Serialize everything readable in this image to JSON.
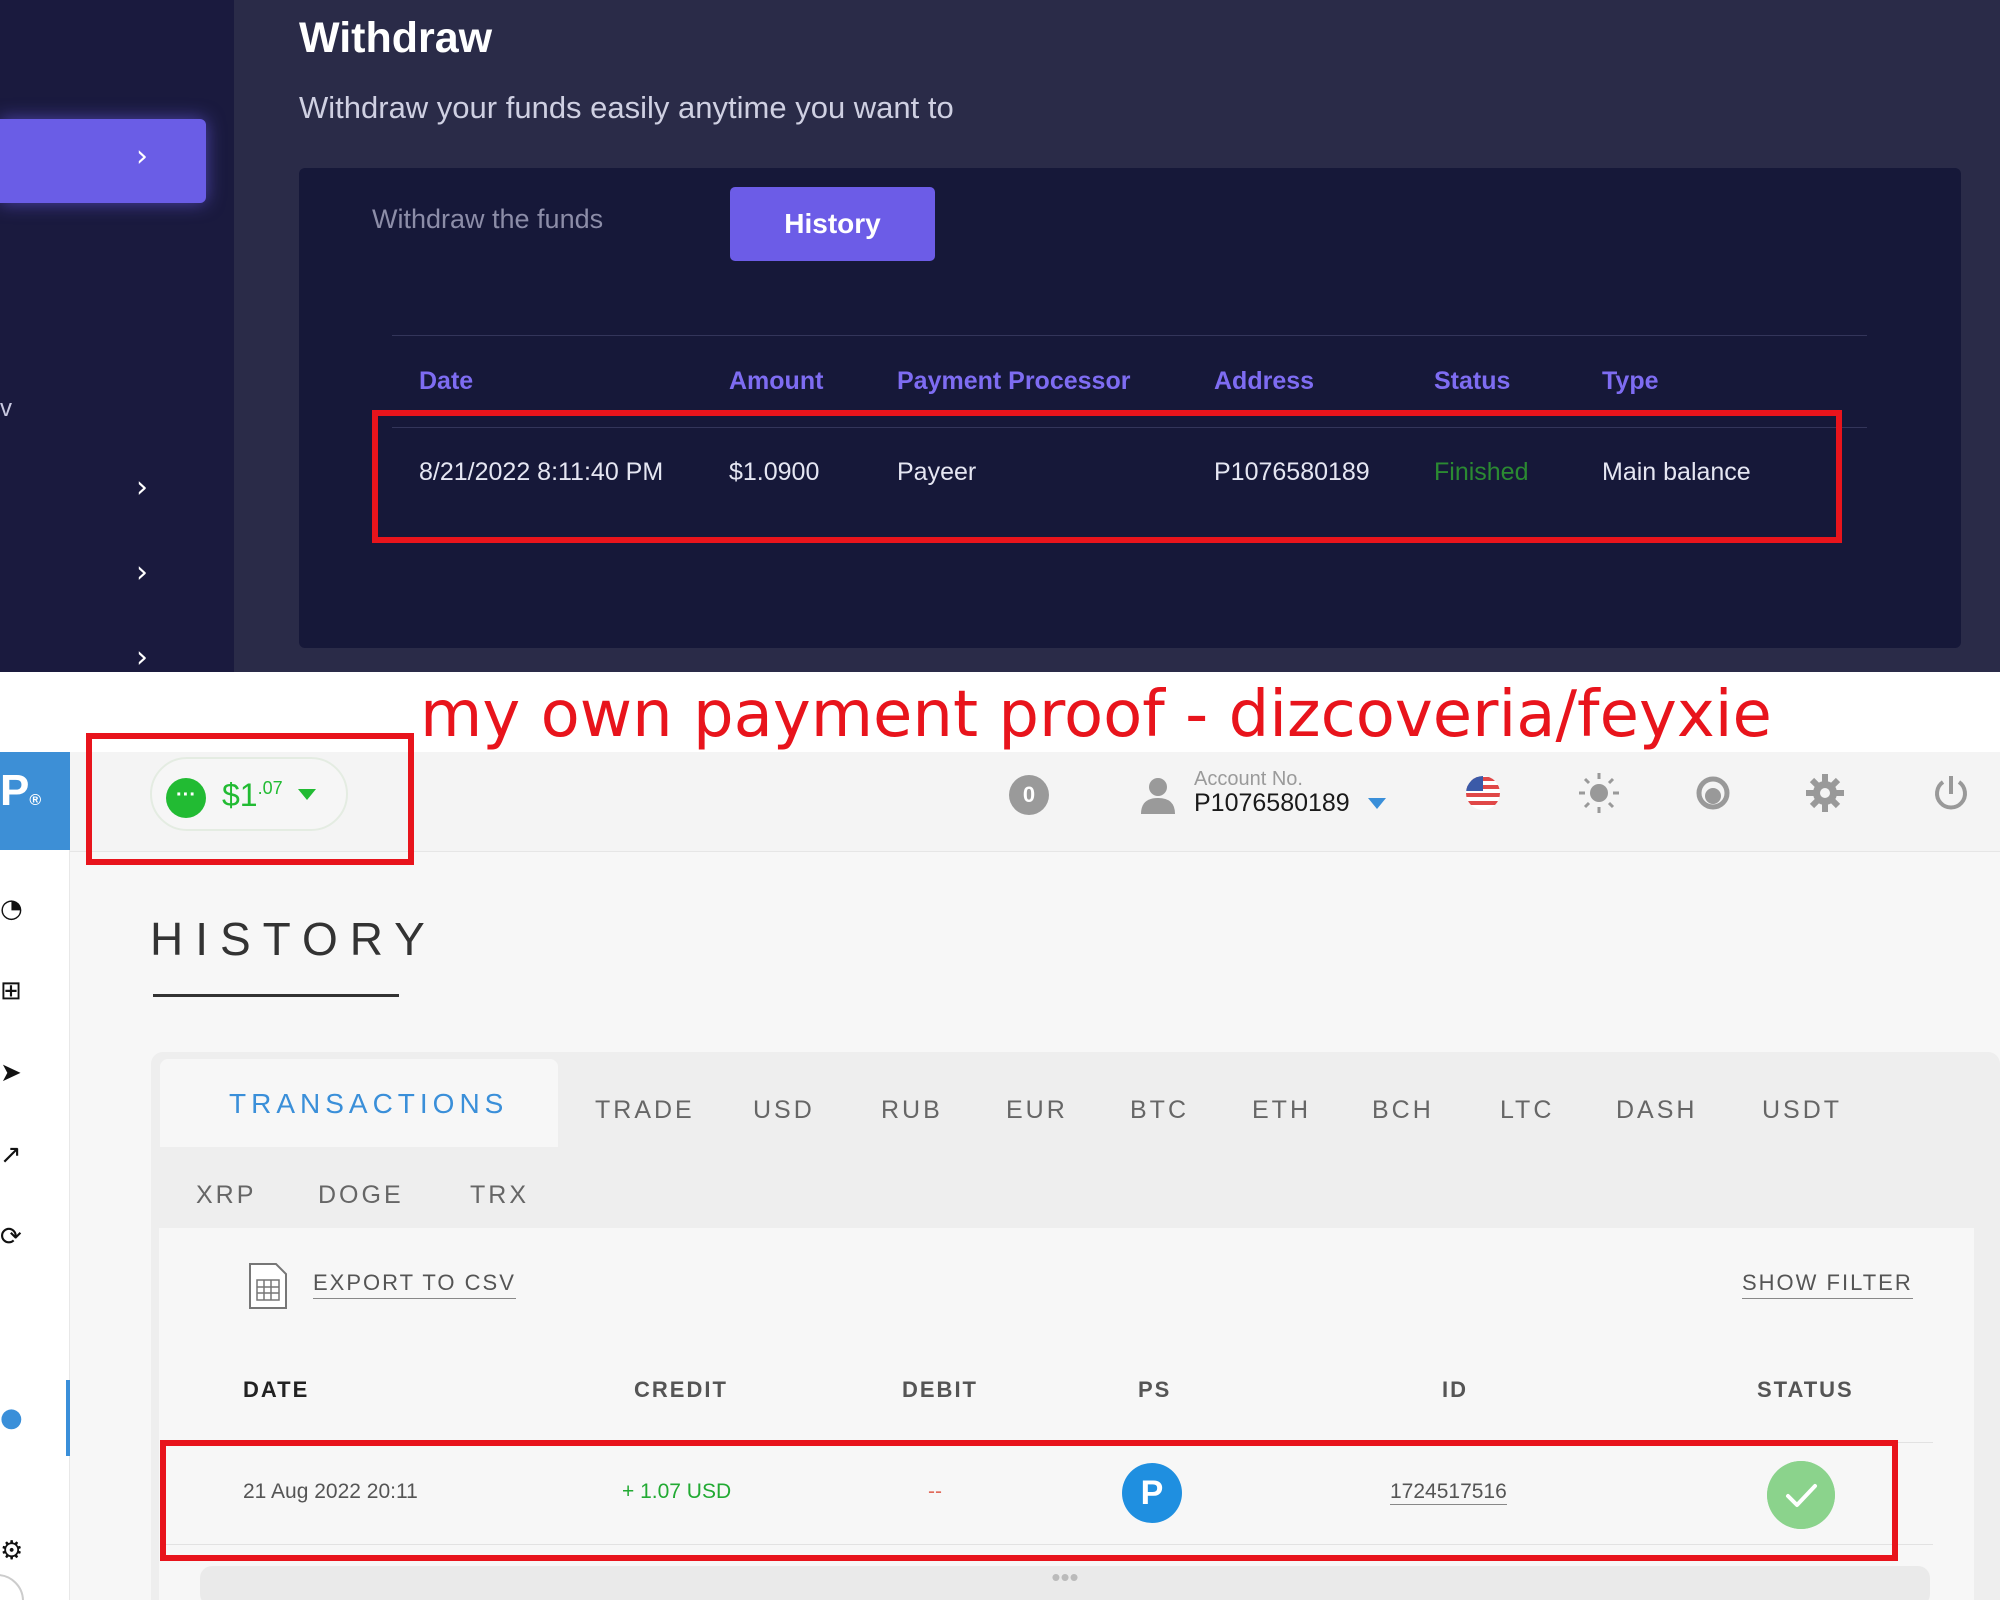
{
  "withdraw": {
    "title": "Withdraw",
    "subtitle": "Withdraw your funds easily anytime you want to",
    "tabs": {
      "funds": "Withdraw the funds",
      "history": "History"
    },
    "columns": [
      "Date",
      "Amount",
      "Payment Processor",
      "Address",
      "Status",
      "Type"
    ],
    "row": {
      "date": "8/21/2022 8:11:40 PM",
      "amount": "$1.0900",
      "processor": "Payeer",
      "address": "P1076580189",
      "status": "Finished",
      "type": "Main balance"
    },
    "sidebar_fragment": "v"
  },
  "caption": "my own payment proof - dizcoveria/feyxie",
  "payeer": {
    "logo": "P",
    "logo_mark": "®",
    "balance": {
      "main": "$1",
      "cents": ".07"
    },
    "notifications": "0",
    "account_label": "Account No.",
    "account_no": "P1076580189",
    "page_title": "HISTORY",
    "tabs": [
      "TRANSACTIONS",
      "TRADE",
      "USD",
      "RUB",
      "EUR",
      "BTC",
      "ETH",
      "BCH",
      "LTC",
      "DASH",
      "USDT",
      "XRP",
      "DOGE",
      "TRX"
    ],
    "export_label": "EXPORT TO CSV",
    "filter_label": "SHOW FILTER",
    "columns": {
      "date": "DATE",
      "credit": "CREDIT",
      "debit": "DEBIT",
      "ps": "PS",
      "id": "ID",
      "status": "STATUS"
    },
    "row": {
      "date": "21 Aug 2022 20:11",
      "credit": "+ 1.07 USD",
      "debit": "--",
      "ps": "P",
      "id": "1724517516"
    },
    "more": "•••"
  },
  "colors": {
    "withdraw_bg": "#2a2b48",
    "accent_purple": "#6c5ce7",
    "payeer_blue": "#3a8fd9",
    "success_green": "#22bb33",
    "highlight_red": "#e8141c"
  }
}
